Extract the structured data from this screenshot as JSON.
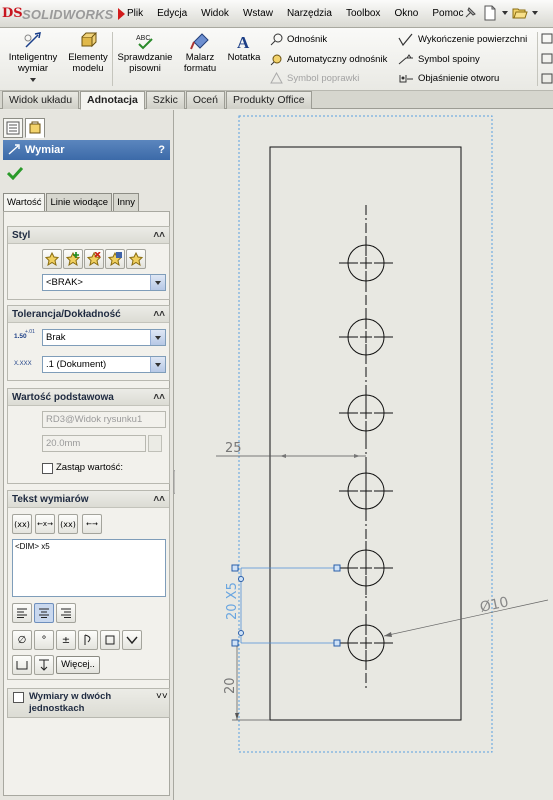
{
  "app": {
    "logo_text": "SOLIDWORKS",
    "logo_prefix": "DS"
  },
  "menu": [
    "Plik",
    "Edycja",
    "Widok",
    "Wstaw",
    "Narzędzia",
    "Toolbox",
    "Okno",
    "Pomoc"
  ],
  "commands": {
    "smart_dimension": [
      "Inteligentny",
      "wymiar"
    ],
    "model_items": [
      "Elementy",
      "modelu"
    ],
    "spell_check": [
      "Sprawdzanie",
      "pisowni"
    ],
    "format_painter": [
      "Malarz",
      "formatu"
    ],
    "note": "Notatka",
    "balloon": "Odnośnik",
    "auto_balloon": "Automatyczny odnośnik",
    "magnetic_line": "Symbol poprawki",
    "surface_finish": "Wykończenie powierzchni",
    "weld_symbol": "Symbol spoiny",
    "hole_callout": "Objaśnienie otworu"
  },
  "tabs": [
    "Widok układu",
    "Adnotacja",
    "Szkic",
    "Oceń",
    "Produkty Office"
  ],
  "active_tab": "Adnotacja",
  "property_manager": {
    "title": "Wymiar",
    "help": "?",
    "subtabs": [
      "Wartość",
      "Linie wiodące",
      "Inny"
    ],
    "style": {
      "header": "Styl",
      "select_value": "<BRAK>"
    },
    "tolerance": {
      "header": "Tolerancja/Dokładność",
      "tolerance_icon_top": "1.50",
      "tolerance_icon_sub": "+.01",
      "tolerance_value": "Brak",
      "precision_icon": "X.XXX",
      "precision_value": ".1 (Dokument)"
    },
    "primary_value": {
      "header": "Wartość podstawowa",
      "reference": "RD3@Widok rysunku1",
      "value": "20.0mm",
      "override_label": "Zastąp wartość:"
    },
    "dimension_text": {
      "header": "Tekst wymiarów",
      "buttons": [
        "(xx)",
        "←x→",
        "(xx)",
        "←→"
      ],
      "text": "<DIM> x5",
      "more_button": "Więcej.."
    },
    "dual": {
      "header_line1": "Wymiary w dwóch",
      "header_line2": "jednostkach"
    }
  },
  "drawing": {
    "dim_horizontal": "25",
    "dim_pattern": "20 X5",
    "dim_vertical": "20",
    "dim_diameter": "Ø10"
  },
  "colors": {
    "header_blue": "#3c6aa8",
    "selected_dimension": "#6aa6e0",
    "sw_red": "#c8141e"
  }
}
